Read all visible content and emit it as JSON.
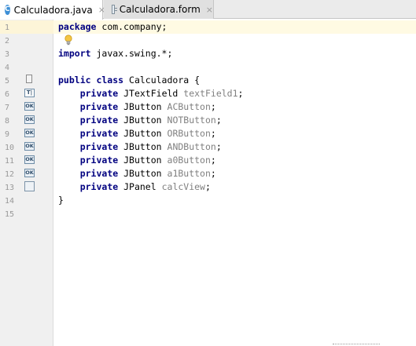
{
  "tabs": [
    {
      "label": "Calculadora.java",
      "icon": "java-class-icon",
      "active": true,
      "close": "×"
    },
    {
      "label": "Calculadora.form",
      "icon": "form-file-icon",
      "active": false,
      "close": "×"
    }
  ],
  "java_icon_glyph": "C",
  "line_numbers": [
    "1",
    "2",
    "3",
    "4",
    "5",
    "6",
    "7",
    "8",
    "9",
    "10",
    "11",
    "12",
    "13",
    "14",
    "15"
  ],
  "code": {
    "l1_kw": "package",
    "l1_rest": " com.company;",
    "l3_kw": "import",
    "l3_rest": " javax.swing.*;",
    "l5_kw": "public class",
    "l5_rest": " Calculadora {",
    "private_kw": "private",
    "fields": [
      {
        "type": "JTextField",
        "name": "textField1"
      },
      {
        "type": "JButton",
        "name": "ACButton"
      },
      {
        "type": "JButton",
        "name": "NOTButton"
      },
      {
        "type": "JButton",
        "name": "ORButton"
      },
      {
        "type": "JButton",
        "name": "ANDButton"
      },
      {
        "type": "JButton",
        "name": "a0Button"
      },
      {
        "type": "JButton",
        "name": "a1Button"
      },
      {
        "type": "JPanel",
        "name": "calcView"
      }
    ],
    "semicolon": ";",
    "l14": "}"
  },
  "gutter_icons": {
    "button_label": "OK",
    "textfield_label": "T|",
    "names": [
      "form-bound-class-icon",
      "textfield-icon",
      "button-icon",
      "button-icon",
      "button-icon",
      "button-icon",
      "button-icon",
      "button-icon",
      "panel-icon"
    ]
  },
  "colors": {
    "keyword": "#000080",
    "field": "#808080",
    "current_line": "#fffae3",
    "gutter": "#f0f0f0"
  }
}
